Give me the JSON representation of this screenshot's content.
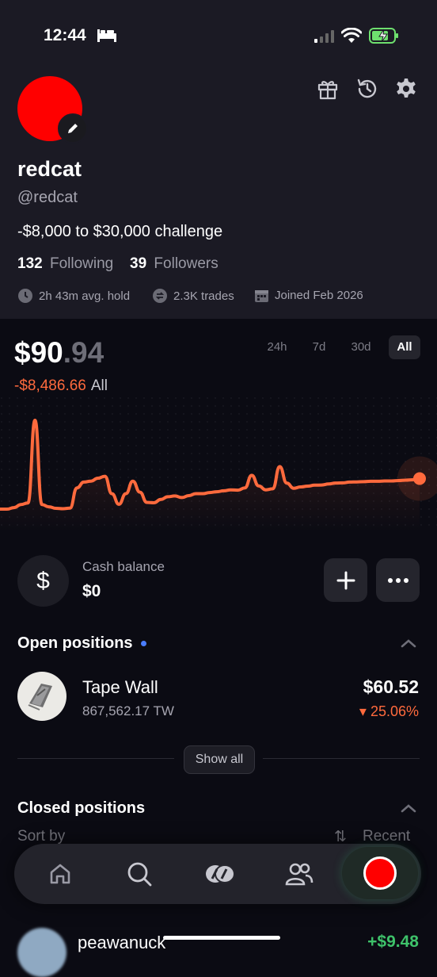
{
  "status_bar": {
    "time": "12:44"
  },
  "profile": {
    "username": "redcat",
    "handle": "@redcat",
    "bio": "-$8,000 to $30,000 challenge",
    "following_count": "132",
    "following_label": "Following",
    "followers_count": "39",
    "followers_label": "Followers",
    "avg_hold": "2h 43m avg. hold",
    "trades": "2.3K trades",
    "joined": "Joined Feb 2026",
    "avatar_color": "#ff0000"
  },
  "portfolio": {
    "value_main": "$90",
    "value_cents": ".94",
    "pnl": "-$8,486.66",
    "pnl_period": "All",
    "ranges": [
      "24h",
      "7d",
      "30d",
      "All"
    ],
    "active_range": "All",
    "accent": "#ff6a3d"
  },
  "chart_data": {
    "type": "line",
    "title": "",
    "xlabel": "",
    "ylabel": "",
    "series": [
      {
        "values": [
          -8000,
          -8000,
          -7920,
          -7760,
          -7680,
          -3400,
          -7760,
          -7880,
          -7960,
          -7980,
          -7950,
          -6900,
          -6600,
          -6550,
          -6400,
          -6300,
          -7200,
          -7750,
          -7200,
          -6550,
          -7120,
          -7650,
          -7670,
          -7500,
          -7360,
          -7320,
          -7400,
          -7300,
          -7200,
          -7200,
          -7140,
          -7100,
          -7050,
          -7000,
          -7020,
          -6900,
          -6250,
          -6800,
          -7000,
          -6950,
          -5800,
          -6650,
          -6920,
          -6850,
          -6810,
          -6760,
          -6750,
          -6700,
          -6650,
          -6640,
          -6600,
          -6590,
          -6580,
          -6560,
          -6560,
          -6540,
          -6540,
          -6520,
          -6500,
          -6480,
          -6420
        ]
      }
    ],
    "grid": false,
    "legend": "none"
  },
  "cash": {
    "icon_glyph": "$",
    "label": "Cash balance",
    "value": "$0"
  },
  "open_positions": {
    "title": "Open positions",
    "items": [
      {
        "name": "Tape Wall",
        "quantity": "867,562.17 TW",
        "value": "$60.52",
        "change": "▾ 25.06%"
      }
    ],
    "show_all": "Show all"
  },
  "closed_positions": {
    "title": "Closed positions",
    "sort_label": "Sort by",
    "sort_value": "Recent",
    "items": [
      {
        "name": "peawanuck",
        "value": "+$9.48"
      }
    ]
  },
  "tabbar": {
    "icons": [
      "home-icon",
      "search-icon",
      "coins-icon",
      "people-icon",
      "record-icon"
    ]
  }
}
